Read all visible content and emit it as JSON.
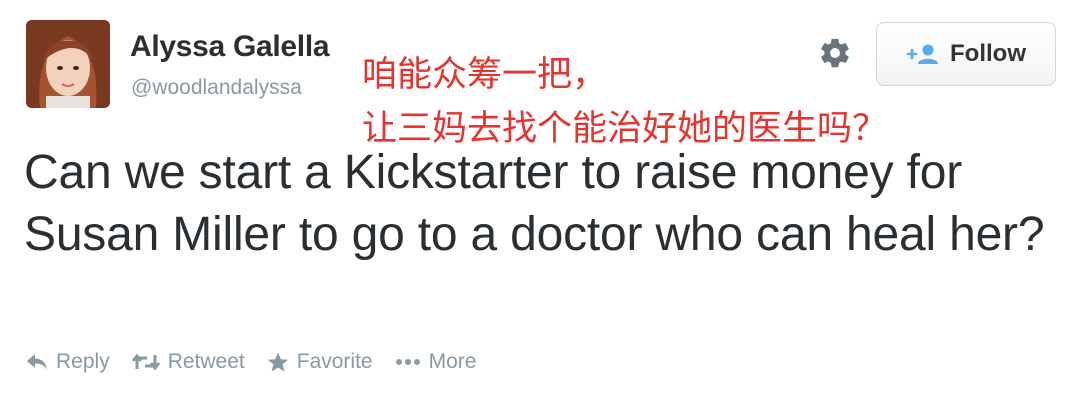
{
  "user": {
    "display_name": "Alyssa Galella",
    "handle": "@woodlandalyssa"
  },
  "follow_button": {
    "label": "Follow"
  },
  "overlay": {
    "line1": "咱能众筹一把，",
    "line2": "让三妈去找个能治好她的医生吗？",
    "color": "#e8322d"
  },
  "tweet": {
    "text": "Can we start a Kickstarter to raise money for Susan Miller to go to a doctor who can heal her?"
  },
  "actions": {
    "reply": "Reply",
    "retweet": "Retweet",
    "favorite": "Favorite",
    "more": "More"
  },
  "colors": {
    "accent": "#55acee",
    "muted": "#8899a6",
    "text": "#292f33"
  }
}
